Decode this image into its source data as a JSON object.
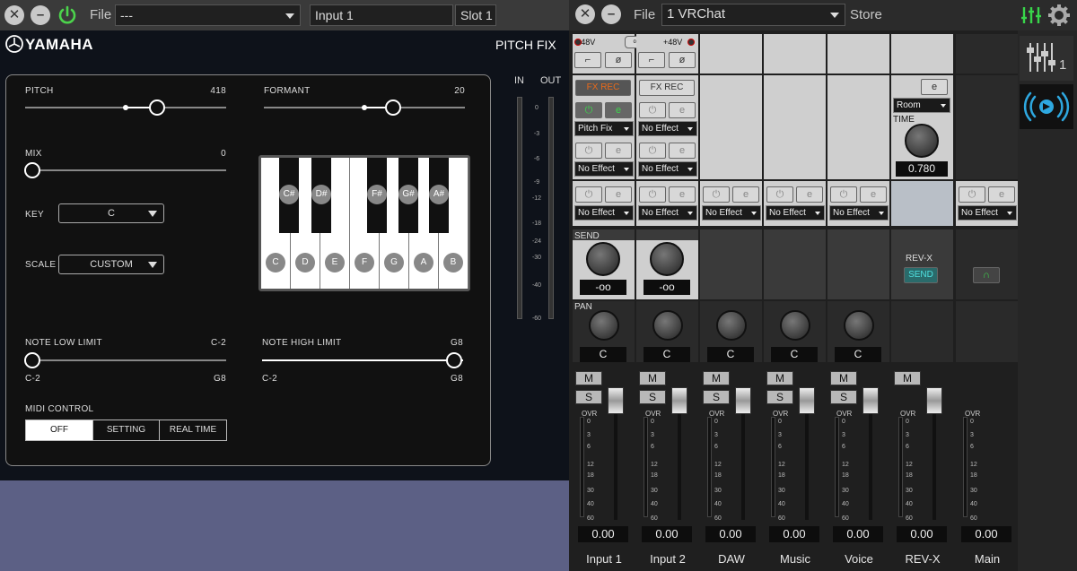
{
  "left_toolbar": {
    "file_label": "File",
    "preset_value": "---",
    "input_value": "Input 1",
    "slot_value": "Slot 1"
  },
  "pitchfix": {
    "brand": "YAMAHA",
    "title": "PITCH FIX",
    "pitch_label": "PITCH",
    "pitch_value": "418",
    "formant_label": "FORMANT",
    "formant_value": "20",
    "mix_label": "MIX",
    "mix_value": "0",
    "key_label": "KEY",
    "key_value": "C",
    "scale_label": "SCALE",
    "scale_value": "CUSTOM",
    "black_keys": [
      "C#",
      "D#",
      "F#",
      "G#",
      "A#"
    ],
    "white_keys": [
      "C",
      "D",
      "E",
      "F",
      "G",
      "A",
      "B"
    ],
    "note_low_label": "NOTE LOW LIMIT",
    "note_low_value": "C-2",
    "note_low_min": "C-2",
    "note_low_max": "G8",
    "note_high_label": "NOTE HIGH LIMIT",
    "note_high_value": "G8",
    "note_high_min": "C-2",
    "note_high_max": "G8",
    "midi_label": "MIDI CONTROL",
    "midi_options": [
      "OFF",
      "SETTING",
      "REAL TIME"
    ],
    "meter_in": "IN",
    "meter_out": "OUT",
    "meter_scale": [
      "0",
      "-3",
      "-6",
      "-9",
      "-12",
      "-18",
      "-24",
      "-30",
      "-40",
      "-60"
    ]
  },
  "right_toolbar": {
    "file_label": "File",
    "scene_value": "1  VRChat",
    "store_label": "Store"
  },
  "mixer": {
    "phantom": "+48V",
    "fx_rec": "FX REC",
    "effect_none": "No Effect",
    "effect_pitch": "Pitch Fix",
    "send_label": "SEND",
    "send_value": "-oo",
    "pan_label": "PAN",
    "pan_value": "C",
    "mute": "M",
    "solo": "S",
    "ovr": "OVR",
    "fader_ticks": [
      "0",
      "3",
      "6",
      "12",
      "18",
      "30",
      "40",
      "60"
    ],
    "fader_value": "0.00",
    "revx_label": "REV-X",
    "revx_send": "SEND",
    "reverb_type": "Room",
    "reverb_time_label": "TIME",
    "reverb_time_value": "0.780",
    "channels": [
      "Input 1",
      "Input 2",
      "DAW",
      "Music",
      "Voice",
      "REV-X",
      "Main"
    ],
    "side_tab_number": "1"
  }
}
